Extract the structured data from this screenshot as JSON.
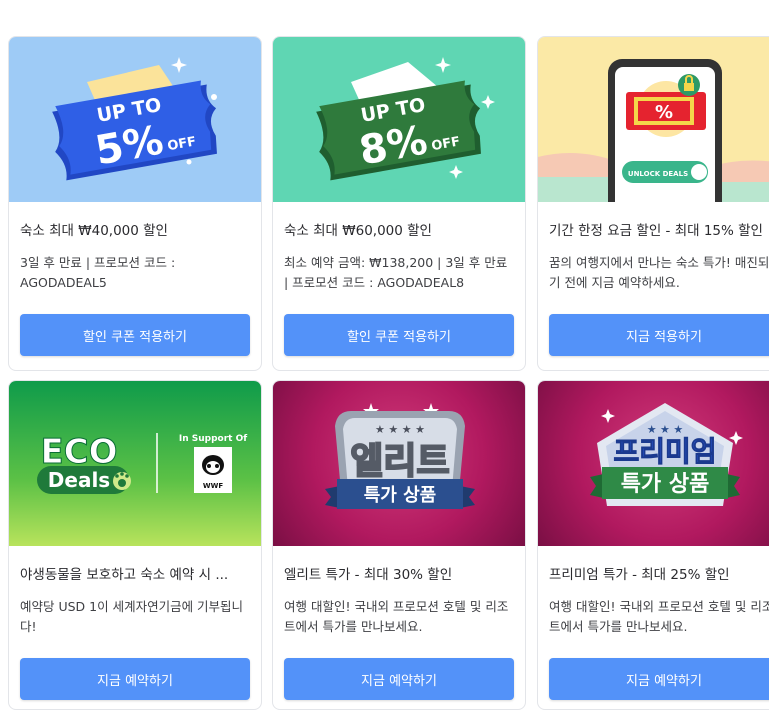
{
  "cards": [
    {
      "banner_text_1": "UP TO",
      "banner_text_2": "5%",
      "banner_text_3": "OFF",
      "title": "숙소 최대 ₩40,000 할인",
      "description": "3일 후 만료 | 프로모션 코드 : AGODADEAL5",
      "button": "할인 쿠폰 적용하기"
    },
    {
      "banner_text_1": "UP TO",
      "banner_text_2": "8%",
      "banner_text_3": "OFF",
      "title": "숙소 최대 ₩60,000 할인",
      "description": "최소 예약 금액: ₩138,200 | 3일 후 만료 | 프로모션 코드 : AGODADEAL8",
      "button": "할인 쿠폰 적용하기"
    },
    {
      "banner_text_1": "%",
      "banner_text_2": "UNLOCK DEALS",
      "title": "기간 한정 요금 할인 - 최대 15% 할인",
      "description": "꿈의 여행지에서 만나는 숙소 특가! 매진되기 전에 지금 예약하세요.",
      "button": "지금 적용하기"
    },
    {
      "banner_text_1": "ECO",
      "banner_text_2": "Deals",
      "banner_text_3": "In Support Of",
      "banner_text_4": "WWF",
      "title": "야생동물을 보호하고 숙소 예약 시 ...",
      "description": "예약당 USD 1이 세계자연기금에 기부됩니다!",
      "button": "지금 예약하기"
    },
    {
      "banner_text_1": "엘리트",
      "banner_text_2": "특가 상품",
      "title": "엘리트 특가 - 최대 30% 할인",
      "description": "여행 대할인! 국내외 프로모션 호텔 및 리조트에서 특가를 만나보세요.",
      "button": "지금 예약하기"
    },
    {
      "banner_text_1": "프리미엄",
      "banner_text_2": "특가 상품",
      "title": "프리미엄 특가 - 최대 25% 할인",
      "description": "여행 대할인! 국내외 프로모션 호텔 및 리조트에서 특가를 만나보세요.",
      "button": "지금 예약하기"
    }
  ],
  "colors": {
    "button": "#5392f9",
    "card_border": "#e3e5e9",
    "banner1_bg": "#9ecbf6",
    "banner2_bg": "#5fd6b3",
    "banner3_bg": "#fbe9a6",
    "banner4_bg": "#1aa14e",
    "banner5_bg": "#b1195f",
    "banner6_bg": "#b1195f"
  }
}
